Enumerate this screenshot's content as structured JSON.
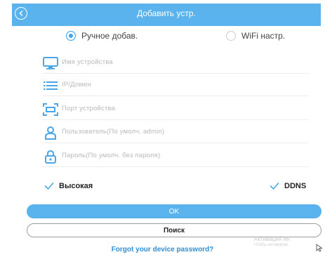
{
  "header": {
    "title": "Добавить устр."
  },
  "mode": {
    "manual_label": "Ручное добав.",
    "wifi_label": "WiFi настр.",
    "selected": "manual"
  },
  "fields": {
    "device_name": "Имя устройства",
    "ip_domain": "IP/Домен",
    "port": "Порт устройства",
    "user": "Пользователь(По умолч. admin)",
    "password": "Пароль(По умолч. без пароля)"
  },
  "options": {
    "high_label": "Высокая",
    "ddns_label": "DDNS",
    "high_checked": true,
    "ddns_checked": true
  },
  "buttons": {
    "ok_label": "OK",
    "search_label": "Поиск"
  },
  "forgot_link": "Forgot your device password?",
  "watermark": {
    "line1": "Активация Wi",
    "line2": "Чтобы активиров"
  },
  "colors": {
    "accent": "#5ab3ed",
    "icon": "#4aa8ea",
    "link": "#2f8fd6"
  }
}
